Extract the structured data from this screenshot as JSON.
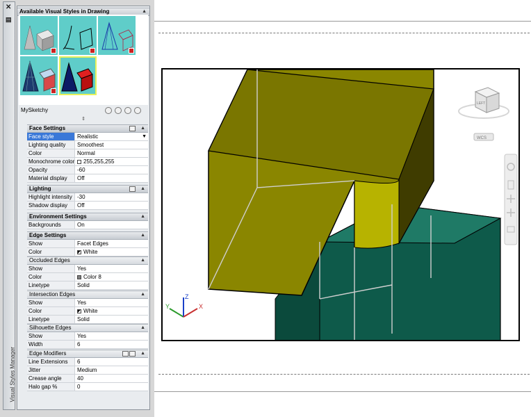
{
  "palette": {
    "title": "Visual Styles Manager",
    "close_glyph": "✕",
    "sections": {
      "available": "Available Visual Styles in Drawing",
      "face": "Face Settings",
      "lighting": "Lighting",
      "environment": "Environment Settings",
      "edge": "Edge Settings",
      "occluded": "Occluded Edges",
      "intersection": "Intersection Edges",
      "silhouette": "Silhouette Edges",
      "modifiers": "Edge Modifiers"
    },
    "current_style": "MySketchy",
    "thumbnails": [
      "realistic-style",
      "sketchy-style",
      "conceptual-style",
      "xray-style",
      "mysketchy-style"
    ]
  },
  "face_settings": [
    {
      "label": "Face style",
      "value": "Realistic"
    },
    {
      "label": "Lighting quality",
      "value": "Smoothest"
    },
    {
      "label": "Color",
      "value": "Normal"
    },
    {
      "label": "Monochrome color",
      "value": "255,255,255"
    },
    {
      "label": "Opacity",
      "value": "-60"
    },
    {
      "label": "Material display",
      "value": "Off"
    }
  ],
  "lighting": [
    {
      "label": "Highlight intensity",
      "value": "-30"
    },
    {
      "label": "Shadow display",
      "value": "Off"
    }
  ],
  "environment": [
    {
      "label": "Backgrounds",
      "value": "On"
    }
  ],
  "edge_settings": [
    {
      "label": "Show",
      "value": "Facet Edges"
    },
    {
      "label": "Color",
      "value": "White"
    }
  ],
  "occluded_edges": [
    {
      "label": "Show",
      "value": "Yes"
    },
    {
      "label": "Color",
      "value": "Color 8"
    },
    {
      "label": "Linetype",
      "value": "Solid"
    }
  ],
  "intersection_edges": [
    {
      "label": "Show",
      "value": "Yes"
    },
    {
      "label": "Color",
      "value": "White"
    },
    {
      "label": "Linetype",
      "value": "Solid"
    }
  ],
  "silhouette_edges": [
    {
      "label": "Show",
      "value": "Yes"
    },
    {
      "label": "Width",
      "value": "6"
    }
  ],
  "edge_modifiers": [
    {
      "label": "Line Extensions",
      "value": "6"
    },
    {
      "label": "Jitter",
      "value": "Medium"
    },
    {
      "label": "Crease angle",
      "value": "40"
    },
    {
      "label": "Halo gap %",
      "value": "0"
    }
  ],
  "viewcube": {
    "face": "LEFT",
    "ucs": "WCS"
  },
  "colors": {
    "accent": "#3a78d8",
    "model_yellow": "#8a8600",
    "model_teal": "#0e5a4a",
    "thumb_bg": "#5fcdc9"
  }
}
